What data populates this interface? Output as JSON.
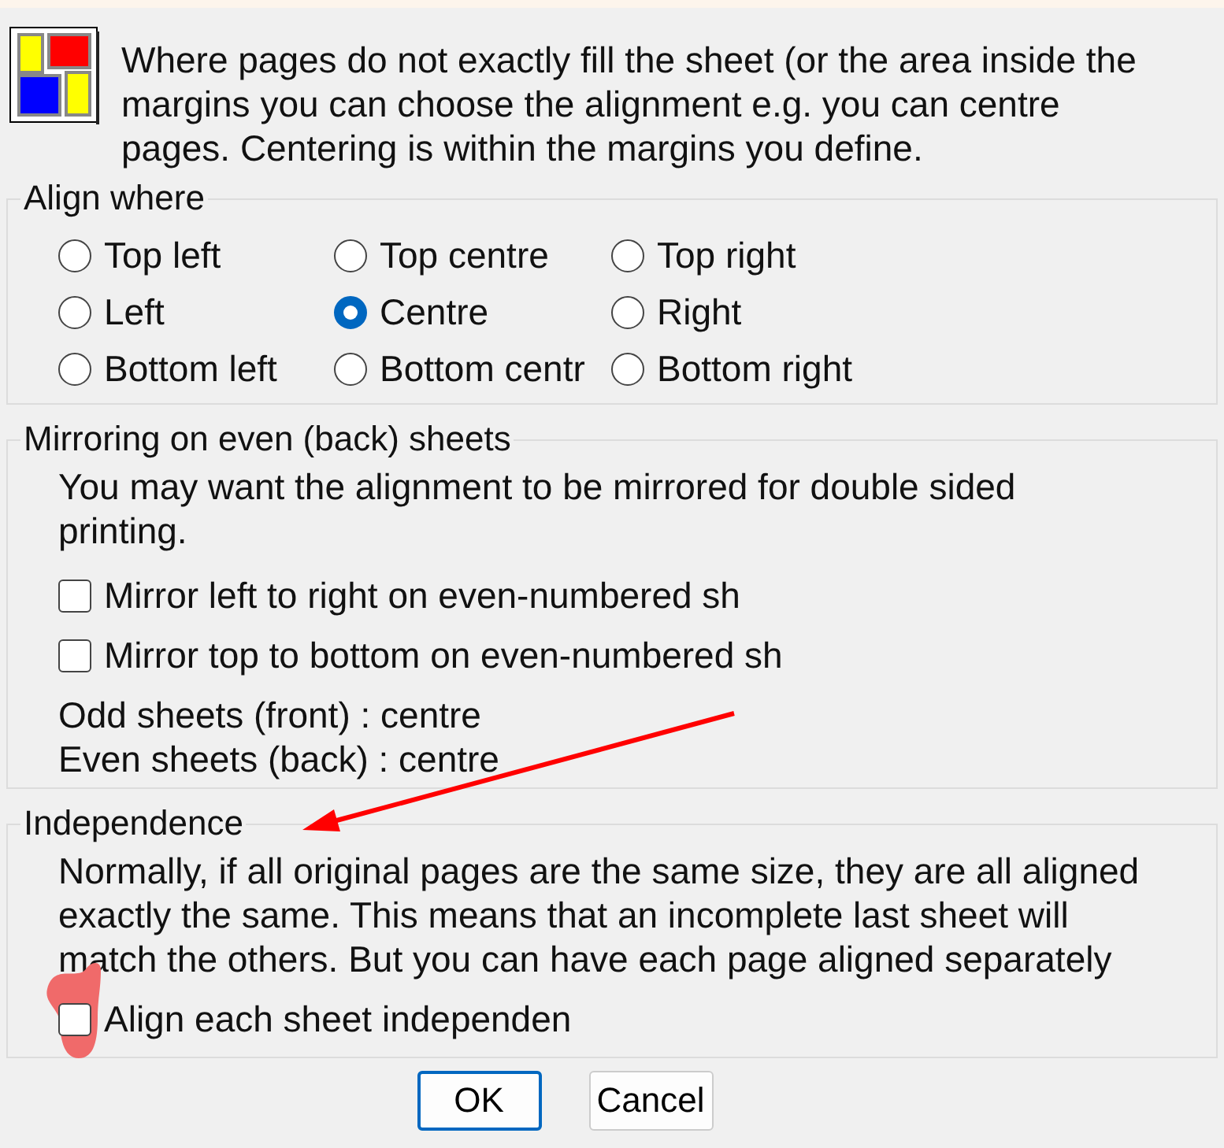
{
  "intro": {
    "text": "Where pages do not exactly fill the sheet (or the area inside the margins you can choose the alignment e.g. you can centre pages. Centering is within the margins you define."
  },
  "align_where": {
    "legend": "Align where",
    "options": [
      {
        "label": "Top left",
        "selected": false
      },
      {
        "label": "Top centre",
        "selected": false
      },
      {
        "label": "Top right",
        "selected": false
      },
      {
        "label": "Left",
        "selected": false
      },
      {
        "label": "Centre",
        "selected": true
      },
      {
        "label": "Right",
        "selected": false
      },
      {
        "label": "Bottom left",
        "selected": false
      },
      {
        "label": "Bottom centr",
        "selected": false
      },
      {
        "label": "Bottom right",
        "selected": false
      }
    ]
  },
  "mirroring": {
    "legend": "Mirroring on even (back) sheets",
    "description": "You may want the alignment to be mirrored for double sided printing.",
    "options": [
      {
        "label": "Mirror left to right on even-numbered sh",
        "checked": false
      },
      {
        "label": "Mirror top to bottom on even-numbered sh",
        "checked": false
      }
    ],
    "summary": [
      "Odd sheets (front) : centre",
      "Even sheets (back) : centre"
    ]
  },
  "independence": {
    "legend": "Independence",
    "description": "Normally, if all original pages are the same size, they are all aligned exactly the same. This means that an incomplete last sheet will match the others. But you can have each page aligned separately",
    "option": {
      "label": "Align each sheet independen",
      "checked": false
    }
  },
  "buttons": [
    {
      "label": "OK",
      "default": true
    },
    {
      "label": "Cancel",
      "default": false
    }
  ],
  "annotations": [
    {
      "kind": "arrow",
      "color": "#ff0000"
    },
    {
      "kind": "highlight",
      "color": "#f06a6a"
    }
  ]
}
